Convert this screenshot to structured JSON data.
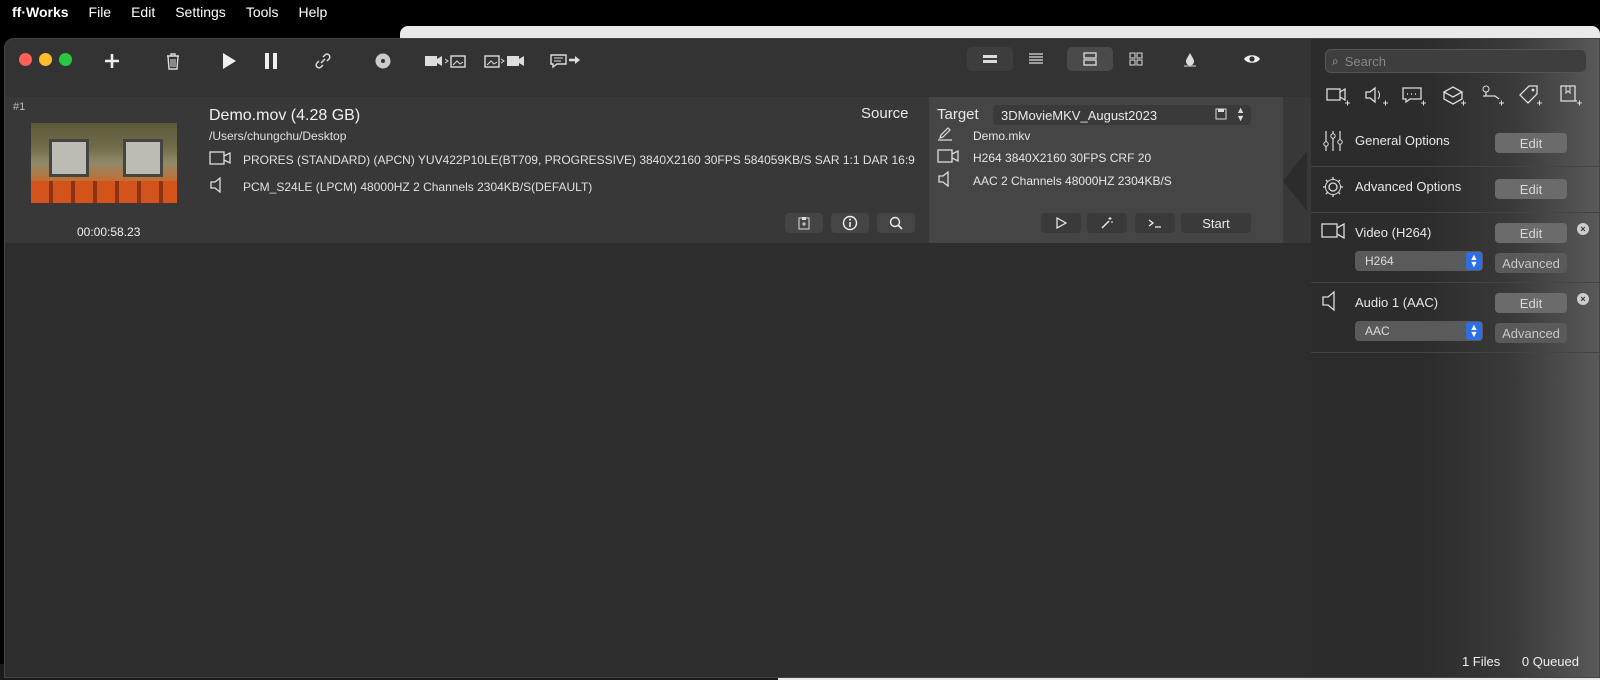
{
  "menubar": {
    "app": "ff·Works",
    "items": [
      "File",
      "Edit",
      "Settings",
      "Tools",
      "Help"
    ]
  },
  "toolbar": {
    "icons": [
      "add-icon",
      "trash-icon",
      "play-icon",
      "pause-icon",
      "link-icon",
      "disc-icon",
      "video-to-image-icon",
      "image-to-video-icon",
      "subtitle-export-icon"
    ],
    "view_icons": [
      "view-compact-icon",
      "view-list-icon",
      "view-detail-icon",
      "view-grid-icon",
      "drop-icon",
      "eye-icon"
    ]
  },
  "job": {
    "number": "#1",
    "title": "Demo.mov  (4.28 GB)",
    "path": "/Users/chungchu/Desktop",
    "video_info": "PRORES (STANDARD) (APCN) YUV422P10LE(BT709, PROGRESSIVE) 3840X2160  30FPS 584059KB/S SAR 1:1 DAR 16:9",
    "audio_info": "PCM_S24LE (LPCM) 48000HZ 2 Channels 2304KB/S(DEFAULT)",
    "duration": "00:00:58.23",
    "source_label": "Source"
  },
  "target": {
    "label": "Target",
    "preset": "3DMovieMKV_August2023",
    "filename": "Demo.mkv",
    "video": "H264 3840X2160 30FPS CRF 20",
    "audio": "AAC 2 Channels 48000HZ 2304KB/S",
    "start_label": "Start"
  },
  "side": {
    "search_placeholder": "Search",
    "sections": {
      "general": {
        "label": "General Options",
        "edit": "Edit"
      },
      "advanced": {
        "label": "Advanced Options",
        "edit": "Edit"
      },
      "video": {
        "label": "Video (H264)",
        "edit": "Edit",
        "codec": "H264",
        "advanced": "Advanced"
      },
      "audio": {
        "label": "Audio 1 (AAC)",
        "edit": "Edit",
        "codec": "AAC",
        "advanced": "Advanced"
      }
    },
    "status_files": "1 Files",
    "status_queued": "0 Queued"
  }
}
